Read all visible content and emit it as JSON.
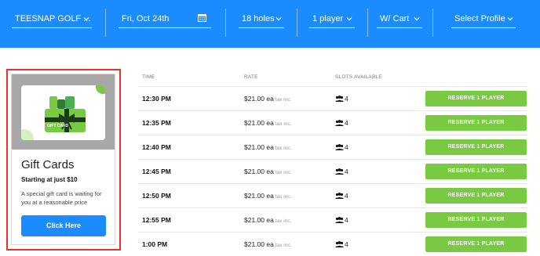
{
  "filters": {
    "course": "TEESNAP GOLF ...",
    "date": "Fri, Oct 24th",
    "holes": "18 holes",
    "players": "1 player",
    "cart": "W/ Cart",
    "profile": "Select Profile"
  },
  "colors": {
    "topbar": "#1a8cff",
    "reserve_button": "#7ac943",
    "promo_button": "#1a8cff",
    "highlight_outline": "#e3342f"
  },
  "promo": {
    "image_label": "GIFT CARD",
    "title": "Gift Cards",
    "subtitle": "Starting at just $10",
    "description": "A special gift card is waiting for you at a reasonable price",
    "button_label": "Click Here"
  },
  "table": {
    "headers": {
      "time": "TIME",
      "rate": "RATE",
      "slots": "SLOTS AVAILABLE"
    },
    "rows": [
      {
        "time": "12:30 PM",
        "rate": "$21.00 ea",
        "tax": "tax inc.",
        "slots": "4",
        "action": "RESERVE 1 PLAYER"
      },
      {
        "time": "12:35 PM",
        "rate": "$21.00 ea",
        "tax": "tax inc.",
        "slots": "4",
        "action": "RESERVE 1 PLAYER"
      },
      {
        "time": "12:40 PM",
        "rate": "$21.00 ea",
        "tax": "tax inc.",
        "slots": "4",
        "action": "RESERVE 1 PLAYER"
      },
      {
        "time": "12:45 PM",
        "rate": "$21.00 ea",
        "tax": "tax inc.",
        "slots": "4",
        "action": "RESERVE 1 PLAYER"
      },
      {
        "time": "12:50 PM",
        "rate": "$21.00 ea",
        "tax": "tax inc.",
        "slots": "4",
        "action": "RESERVE 1 PLAYER"
      },
      {
        "time": "12:55 PM",
        "rate": "$21.00 ea",
        "tax": "tax inc.",
        "slots": "4",
        "action": "RESERVE 1 PLAYER"
      },
      {
        "time": "1:00 PM",
        "rate": "$21.00 ea",
        "tax": "tax inc.",
        "slots": "4",
        "action": "RESERVE 1 PLAYER"
      }
    ]
  },
  "icons": {
    "dropdown": "chevron-down-icon",
    "calendar": "calendar-icon",
    "players": "users-icon"
  }
}
